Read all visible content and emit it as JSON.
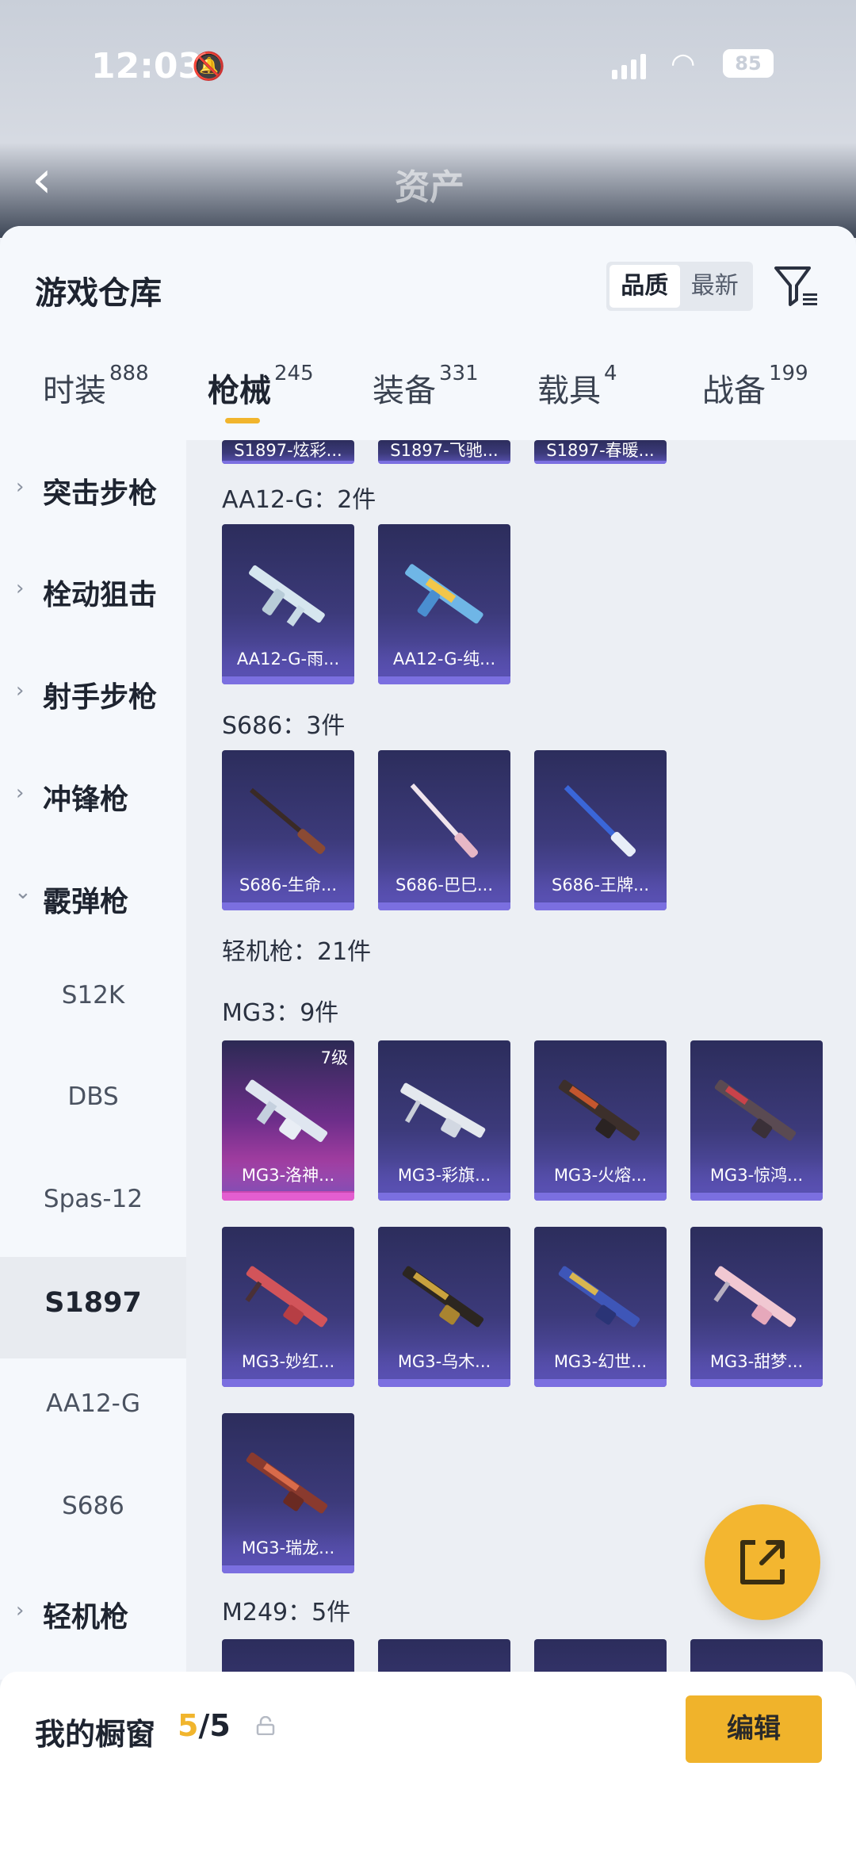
{
  "status_bar": {
    "time": "12:03",
    "battery": "85"
  },
  "ghost_header": {
    "title": "资产"
  },
  "header": {
    "title": "游戏仓库",
    "sort_options": [
      "品质",
      "最新"
    ],
    "active_sort": "品质"
  },
  "tabs": [
    {
      "label": "时装",
      "count": "888"
    },
    {
      "label": "枪械",
      "count": "245"
    },
    {
      "label": "装备",
      "count": "331"
    },
    {
      "label": "载具",
      "count": "4"
    },
    {
      "label": "战备",
      "count": "199"
    }
  ],
  "active_tab": "枪械",
  "sidebar": {
    "categories": [
      {
        "label": "突击步枪",
        "expanded": false
      },
      {
        "label": "栓动狙击",
        "expanded": false
      },
      {
        "label": "射手步枪",
        "expanded": false
      },
      {
        "label": "冲锋枪",
        "expanded": false
      },
      {
        "label": "霰弹枪",
        "expanded": true
      }
    ],
    "subitems": [
      "S12K",
      "DBS",
      "Spas-12",
      "S1897",
      "AA12-G",
      "S686"
    ],
    "active_subitem": "S1897",
    "after": {
      "label": "轻机枪",
      "expanded": false
    }
  },
  "content": {
    "top_partial_cards": [
      "S1897-炫彩...",
      "S1897-飞驰...",
      "S1897-春暖..."
    ],
    "groups": [
      {
        "label": "AA12-G：2件",
        "items": [
          "AA12-G-雨...",
          "AA12-G-纯..."
        ]
      },
      {
        "label": "S686：3件",
        "items": [
          "S686-生命...",
          "S686-巴巳...",
          "S686-王牌..."
        ]
      },
      {
        "label": "轻机枪：21件",
        "items": []
      },
      {
        "label": "MG3：9件",
        "items": [
          "MG3-洛神...",
          "MG3-彩旗...",
          "MG3-火熔...",
          "MG3-惊鸿...",
          "MG3-妙红...",
          "MG3-乌木...",
          "MG3-幻世...",
          "MG3-甜梦...",
          "MG3-瑞龙..."
        ]
      },
      {
        "label": "M249：5件",
        "items": []
      }
    ],
    "featured_level": "7级"
  },
  "bottom_bar": {
    "label": "我的橱窗",
    "current": "5",
    "total": "/5",
    "edit_label": "编辑"
  },
  "colors": {
    "accent": "#f1b52d",
    "card_purple": "#3c3a7a",
    "card_pink": "#d24bb5"
  },
  "icons": [
    "back-icon",
    "filter-icon",
    "chevron-right-icon",
    "chevron-down-icon",
    "share-icon",
    "lock-icon",
    "bell-off-icon",
    "wifi-icon"
  ]
}
